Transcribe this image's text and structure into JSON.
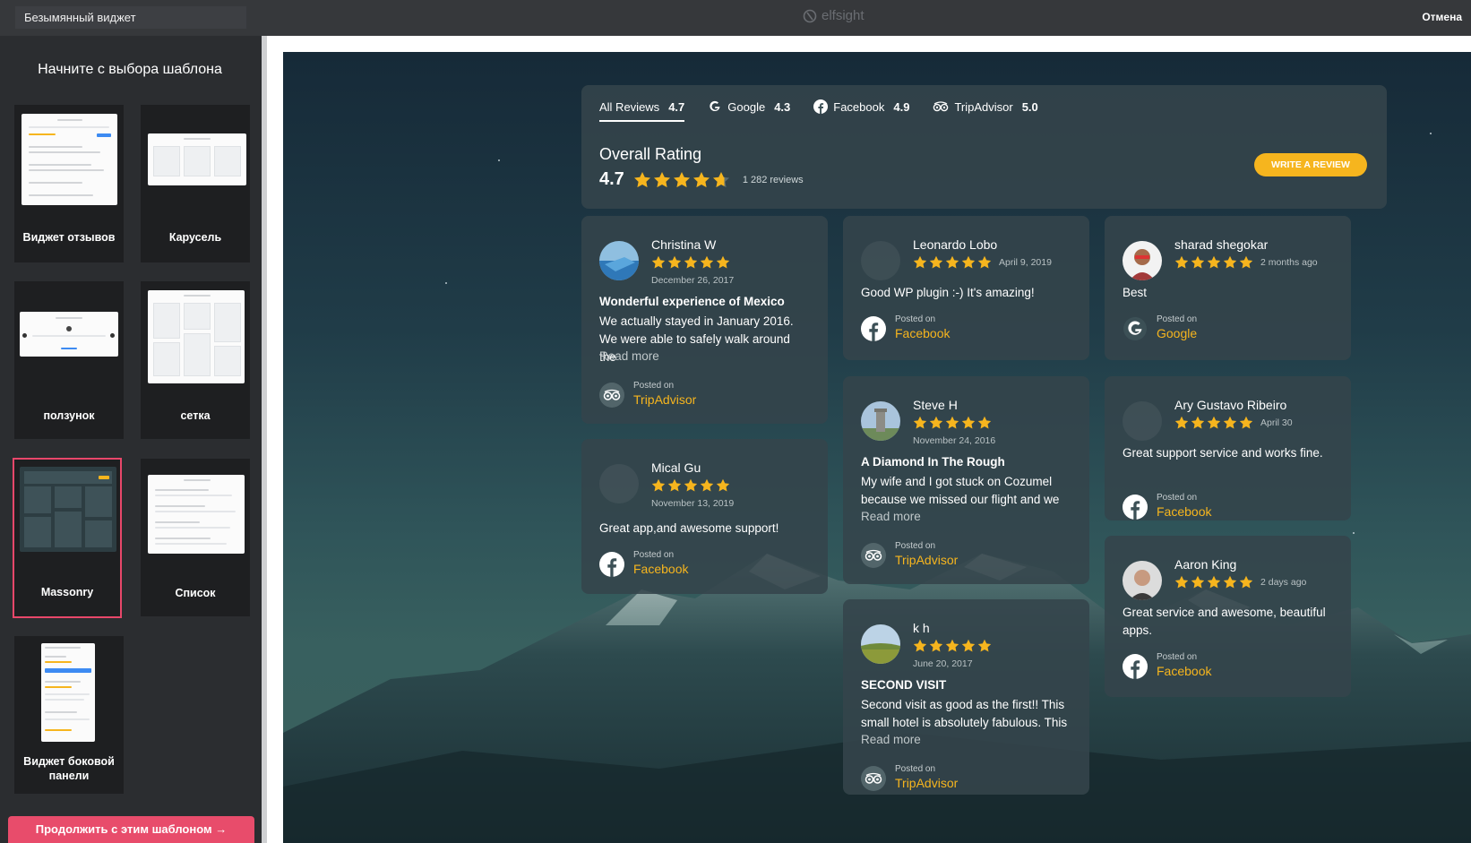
{
  "topbar": {
    "widget_name": "Безымянный виджет",
    "brand": "elfsight",
    "cancel": "Отмена"
  },
  "sidebar": {
    "title": "Начните с выбора шаблона",
    "templates": [
      {
        "label": "Виджет отзывов",
        "active": false
      },
      {
        "label": "Карусель",
        "active": false
      },
      {
        "label": "ползунок",
        "active": false
      },
      {
        "label": "сетка",
        "active": false
      },
      {
        "label": "Massonry",
        "active": true
      },
      {
        "label": "Список",
        "active": false
      },
      {
        "label": "Виджет боковой панели",
        "active": false
      }
    ],
    "cta": "Продолжить с этим шаблоном →"
  },
  "widget": {
    "tabs": [
      {
        "label": "All Reviews",
        "rating": "4.7",
        "icon": "all"
      },
      {
        "label": "Google",
        "rating": "4.3",
        "icon": "google"
      },
      {
        "label": "Facebook",
        "rating": "4.9",
        "icon": "facebook"
      },
      {
        "label": "TripAdvisor",
        "rating": "5.0",
        "icon": "tripadvisor"
      }
    ],
    "overall_title": "Overall Rating",
    "overall_value": "4.7",
    "overall_stars": 4.7,
    "reviews_count": "1 282 reviews",
    "write_review": "WRITE A REVIEW",
    "posted_on": "Posted on",
    "read_more": "Read more",
    "reviews": [
      {
        "name": "Christina W",
        "date": "December 26, 2017",
        "title": "Wonderful experience of Mexico",
        "text": "We actually stayed in January 2016. We were able to safely walk around the",
        "read_more": true,
        "platform": "TripAdvisor",
        "avatar": "photo-pool",
        "stars": 5
      },
      {
        "name": "Mical Gu",
        "date": "November 13, 2019",
        "title": "",
        "text": "Great app,and awesome support!",
        "read_more": false,
        "platform": "Facebook",
        "avatar": "blank",
        "stars": 5
      },
      {
        "name": "Leonardo Lobo",
        "date": "April 9, 2019",
        "title": "",
        "text": "Good WP plugin :-) It's amazing!",
        "read_more": false,
        "platform": "Facebook",
        "avatar": "blank",
        "stars": 5
      },
      {
        "name": "Steve H",
        "date": "November 24, 2016",
        "title": "A Diamond In The Rough",
        "text": "My wife and I got stuck on Cozumel because we missed our flight and we",
        "read_more": true,
        "platform": "TripAdvisor",
        "avatar": "photo-tower",
        "stars": 5
      },
      {
        "name": "k h",
        "date": "June 20, 2017",
        "title": "SECOND VISIT",
        "text": "Second visit as good as the first!! This small hotel is absolutely fabulous. This",
        "read_more": true,
        "platform": "TripAdvisor",
        "avatar": "photo-field",
        "stars": 5
      },
      {
        "name": "sharad shegokar",
        "date": "2 months ago",
        "title": "",
        "text": "Best",
        "read_more": false,
        "platform": "Google",
        "avatar": "photo-person",
        "stars": 5
      },
      {
        "name": "Ary Gustavo Ribeiro",
        "date": "April 30",
        "title": "",
        "text": "Great support service and works fine.",
        "read_more": false,
        "platform": "Facebook",
        "avatar": "blank",
        "stars": 5
      },
      {
        "name": "Aaron King",
        "date": "2 days ago",
        "title": "",
        "text": "Great service and awesome, beautiful apps.",
        "read_more": false,
        "platform": "Facebook",
        "avatar": "photo-man",
        "stars": 5
      }
    ]
  },
  "colors": {
    "accent": "#f6b51e",
    "cta": "#e84c6b",
    "active_border": "#e8476a"
  }
}
